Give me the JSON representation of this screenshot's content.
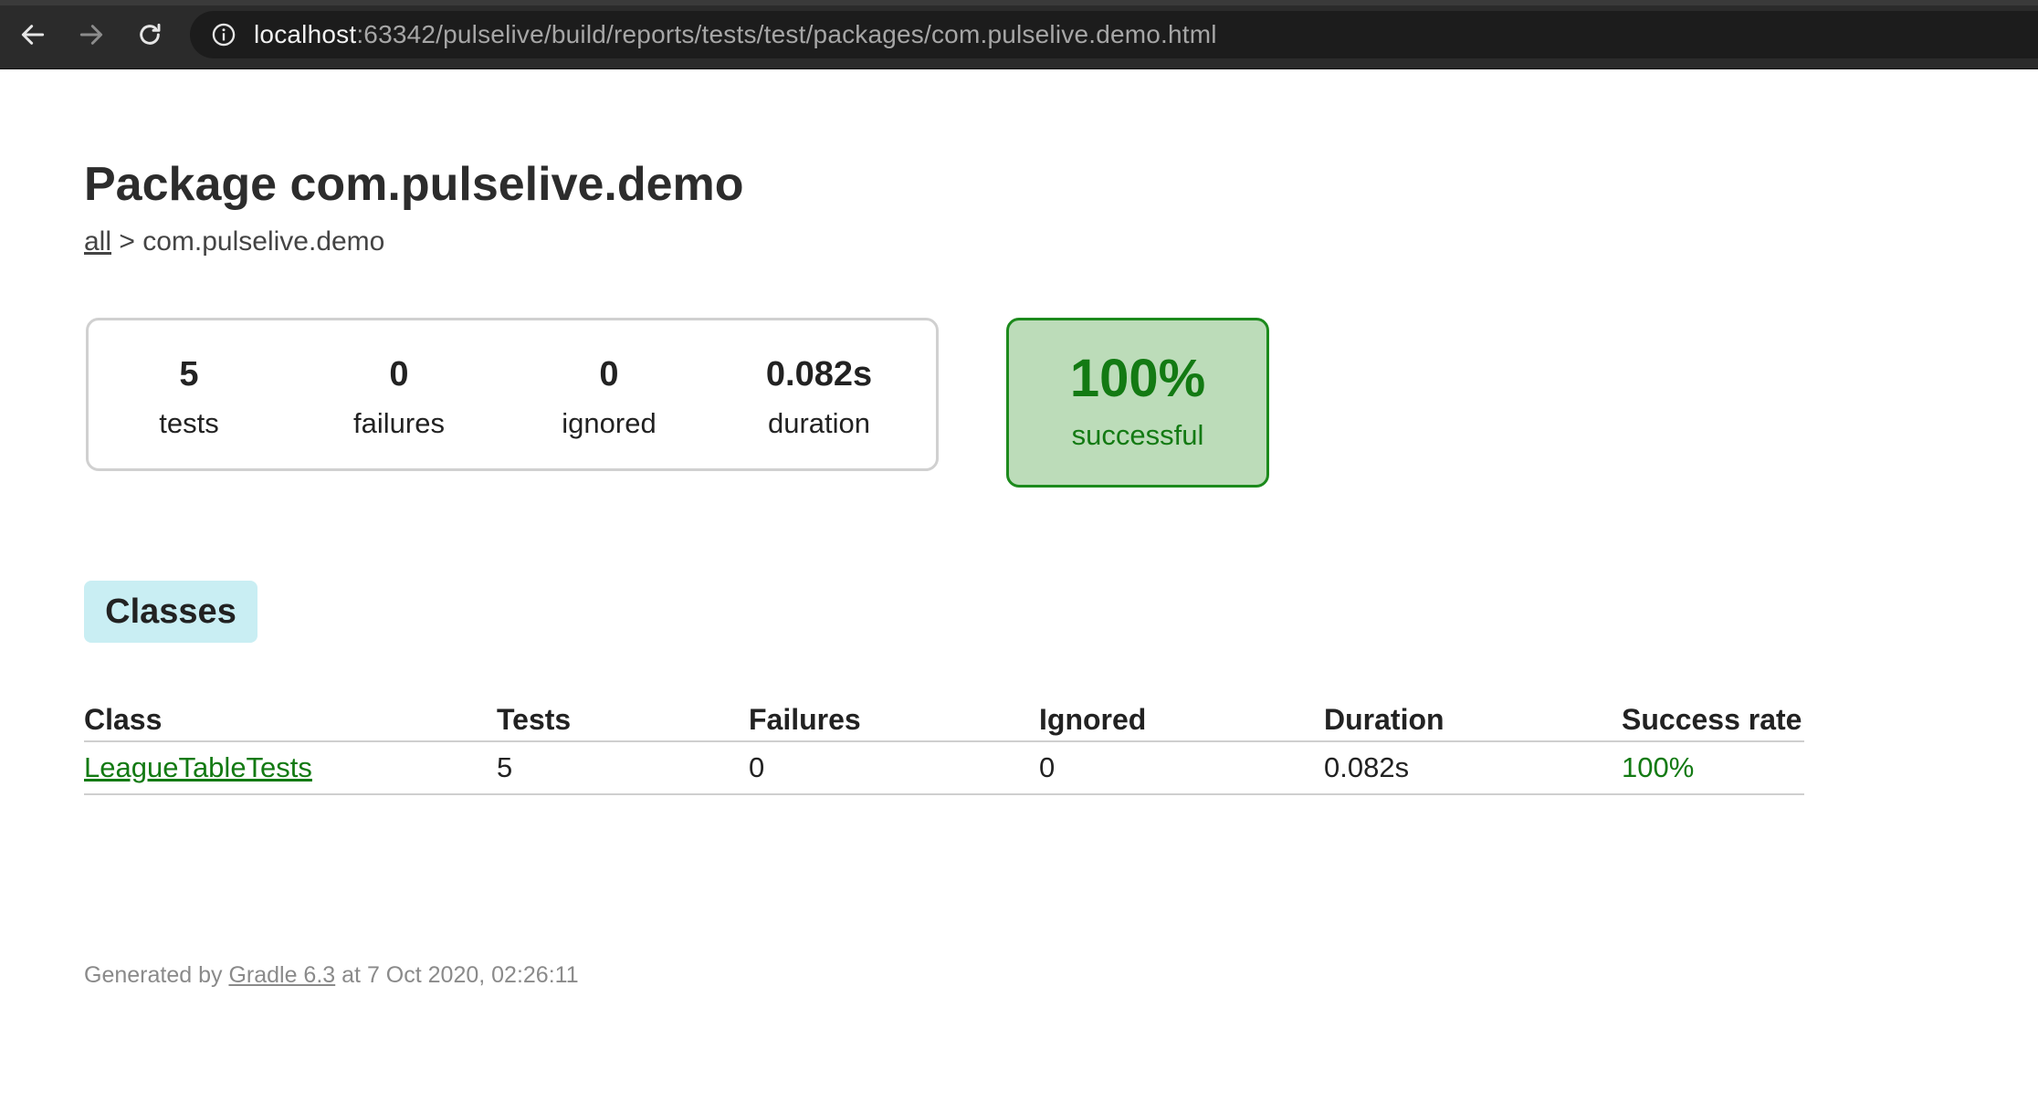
{
  "browser": {
    "url_host": "localhost",
    "url_path": ":63342/pulselive/build/reports/tests/test/packages/com.pulselive.demo.html",
    "icons": [
      "back-icon",
      "forward-icon",
      "reload-icon",
      "info-icon"
    ]
  },
  "page": {
    "title": "Package com.pulselive.demo",
    "breadcrumb": {
      "link": "all",
      "separator": ">",
      "current": "com.pulselive.demo"
    }
  },
  "summary": {
    "tests": {
      "value": "5",
      "label": "tests"
    },
    "failures": {
      "value": "0",
      "label": "failures"
    },
    "ignored": {
      "value": "0",
      "label": "ignored"
    },
    "duration": {
      "value": "0.082s",
      "label": "duration"
    }
  },
  "success": {
    "percent": "100%",
    "label": "successful",
    "color": "#137a13",
    "background": "#bcdcb9"
  },
  "tabs": [
    {
      "label": "Classes",
      "active": true
    }
  ],
  "table": {
    "headers": [
      "Class",
      "Tests",
      "Failures",
      "Ignored",
      "Duration",
      "Success rate"
    ],
    "rows": [
      {
        "class": "LeagueTableTests",
        "tests": "5",
        "failures": "0",
        "ignored": "0",
        "duration": "0.082s",
        "success_rate": "100%"
      }
    ]
  },
  "footer": {
    "prefix": "Generated by",
    "link": "Gradle 6.3",
    "suffix": "at 7 Oct 2020, 02:26:11"
  }
}
